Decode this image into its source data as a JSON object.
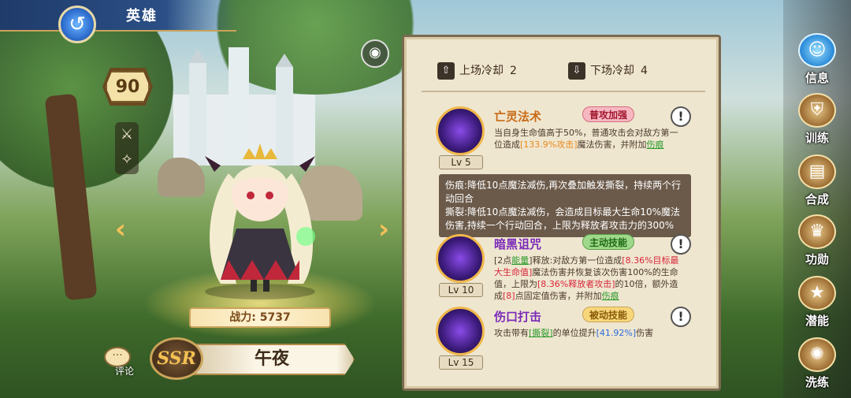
{
  "header": {
    "title": "英雄",
    "back_icon": "back-arrow-icon"
  },
  "hero": {
    "level": "90",
    "power_label": "战力: 5737",
    "rarity": "SSR",
    "name": "午夜",
    "comment_label": "评论"
  },
  "cooldown": {
    "up_label": "上场冷却",
    "up_value": "2",
    "down_label": "下场冷却",
    "down_value": "4"
  },
  "skills": [
    {
      "name": "亡灵法术",
      "tag": "普攻加强",
      "level": "Lv 5",
      "desc_1": "当自身生命值高于50%，普通攻击会对敌方第一位造成",
      "desc_hl": "[133.9%攻击]",
      "desc_2": "魔法伤害，并附加",
      "desc_link": "伤痕"
    },
    {
      "name": "暗黑诅咒",
      "tag": "主动技能",
      "level": "Lv 10",
      "desc_1": "[2点",
      "desc_energy": "能量",
      "desc_2": "]释放:对敌方第一位造成",
      "desc_hl1": "[8.36%目标最大生命值]",
      "desc_3": "魔法伤害并恢复该次伤害100%的生命值，上限为",
      "desc_hl2": "[8.36%释放者攻击]",
      "desc_4": "的10倍，额外造成",
      "desc_hl3": "[8]",
      "desc_5": "点固定值伤害，并附加",
      "desc_link": "伤痕"
    },
    {
      "name": "伤口打击",
      "tag": "被动技能",
      "level": "Lv 15",
      "desc_1": "攻击带有",
      "desc_link": "[撕裂]",
      "desc_2": "的单位提升",
      "desc_hl": "[41.92%]",
      "desc_3": "伤害"
    }
  ],
  "tooltip": {
    "line1": "伤痕:降低10点魔法减伤,再次叠加触发撕裂，持续两个行动回合",
    "line2": "撕裂:降低10点魔法减伤，会造成目标最大生命10%魔法伤害,持续一个行动回合，上限为释放者攻击力的300%"
  },
  "nav": [
    {
      "label": "信息",
      "icon": "info-icon"
    },
    {
      "label": "训练",
      "icon": "training-icon"
    },
    {
      "label": "合成",
      "icon": "synthesis-icon"
    },
    {
      "label": "功勋",
      "icon": "merit-icon"
    },
    {
      "label": "潜能",
      "icon": "potential-icon"
    },
    {
      "label": "洗练",
      "icon": "refine-icon"
    }
  ],
  "colors": {
    "accent": "#c9a35a",
    "panel": "#efe6d0",
    "highlight_red": "#d8263a",
    "highlight_green": "#2a9a2a"
  }
}
